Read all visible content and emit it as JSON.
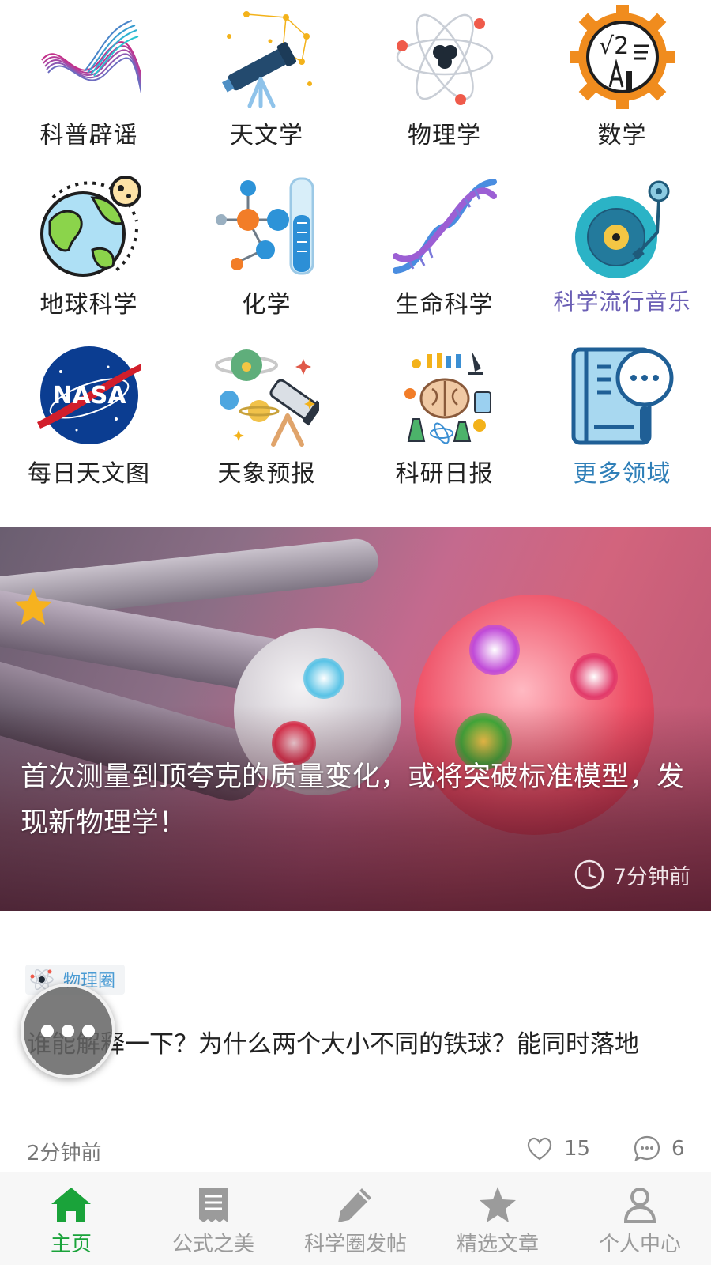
{
  "categories": [
    {
      "label": "科普辟谣",
      "icon": "wave-lines-icon"
    },
    {
      "label": "天文学",
      "icon": "telescope-constellation-icon"
    },
    {
      "label": "物理学",
      "icon": "atom-icon"
    },
    {
      "label": "数学",
      "icon": "math-gear-icon"
    },
    {
      "label": "地球科学",
      "icon": "earth-moon-icon"
    },
    {
      "label": "化学",
      "icon": "molecule-test-tube-icon"
    },
    {
      "label": "生命科学",
      "icon": "dna-icon"
    },
    {
      "label": "科学流行音乐",
      "icon": "vinyl-record-icon"
    },
    {
      "label": "每日天文图",
      "icon": "nasa-logo-icon"
    },
    {
      "label": "天象预报",
      "icon": "planets-telescope-icon"
    },
    {
      "label": "科研日报",
      "icon": "brain-lab-icon"
    },
    {
      "label": "更多领域",
      "icon": "book-magnifier-icon"
    }
  ],
  "banner": {
    "title": "首次测量到顶夸克的质量变化，或将突破标准模型，发现新物理学！",
    "time": "7分钟前",
    "icons": {
      "badge": "star-icon",
      "clock": "clock-icon"
    }
  },
  "post": {
    "tag": "物理圈",
    "title": "谁能解释一下？为什么两个大小不同的铁球？能同时落地",
    "time": "2分钟前",
    "likes": "15",
    "comments": "6"
  },
  "colors": {
    "active": "#1aa33a",
    "inactive": "#9b9b9b",
    "purple_label": "#6b5fb5",
    "blue_label": "#2f7fb8"
  },
  "nav": [
    {
      "label": "主页",
      "icon": "home-icon",
      "active": true
    },
    {
      "label": "公式之美",
      "icon": "document-icon",
      "active": false
    },
    {
      "label": "科学圈发帖",
      "icon": "pencil-icon",
      "active": false
    },
    {
      "label": "精选文章",
      "icon": "star-icon",
      "active": false
    },
    {
      "label": "个人中心",
      "icon": "user-icon",
      "active": false
    }
  ]
}
